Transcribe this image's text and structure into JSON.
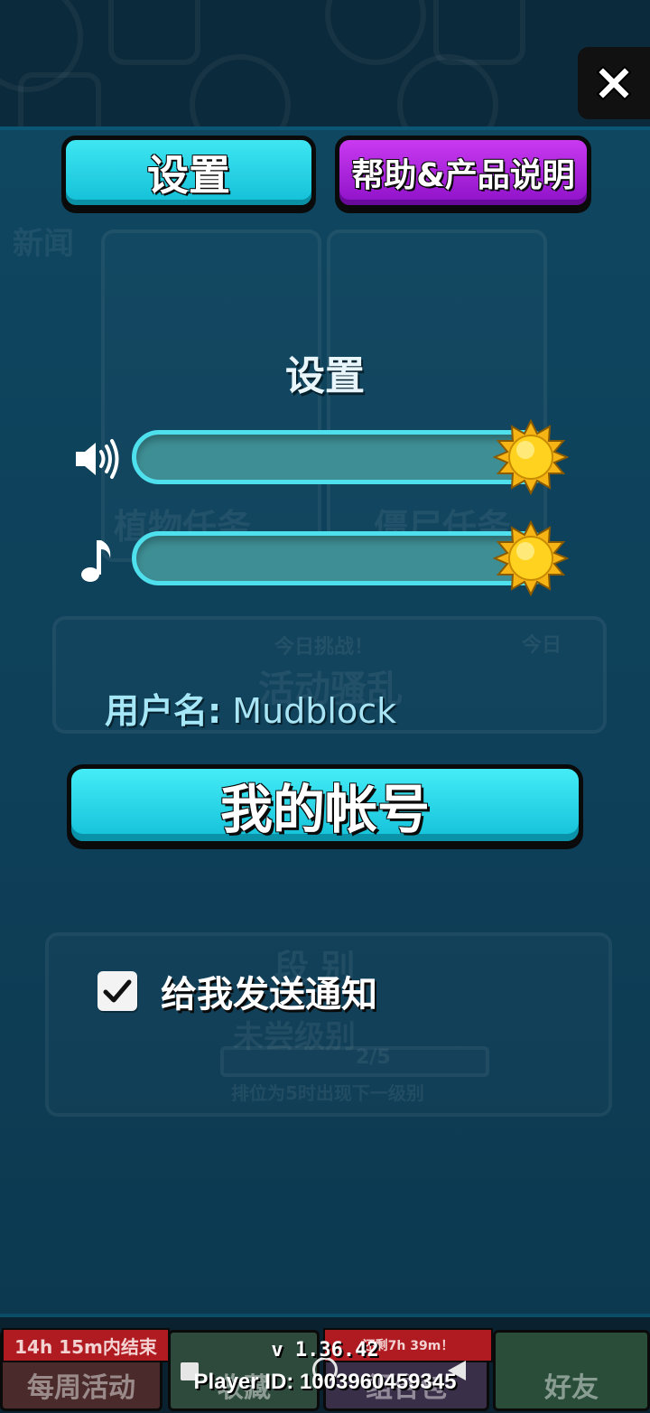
{
  "tabs": {
    "settings_label": "设置",
    "help_label": "帮助&产品说明"
  },
  "settings": {
    "title": "设置",
    "sound_level": 1.0,
    "music_level": 1.0,
    "username_label": "用户名:",
    "username_value": "Mudblock",
    "account_button": "我的帐号",
    "notification_label": "给我发送通知",
    "notification_checked": true
  },
  "background": {
    "news_label": "新闻",
    "plant_tasks": "植物任务",
    "zombie_tasks": "僵尸任务",
    "daily_challenge": "今日挑战！",
    "daily_event": "活动骚乱",
    "today": "今日",
    "rank_title": "段   别",
    "rank_subtitle": "未尝级别",
    "rank_progress": "2/5",
    "rank_hint": "排位为5时出现下一级别"
  },
  "bottom_nav": {
    "weekly_timer": "14h 15m内结束",
    "weekly_label": "每周活动",
    "collection_label": "收藏",
    "middle_timer": "还剩7h 39m！",
    "middle_label": "组合包",
    "friends_label": "好友"
  },
  "footer": {
    "version": "v 1.36.42",
    "player_id": "Player ID: 1003960459345"
  },
  "colors": {
    "accent_cyan": "#1fd0e4",
    "accent_purple": "#a71fe0",
    "background": "#0e3f58"
  }
}
